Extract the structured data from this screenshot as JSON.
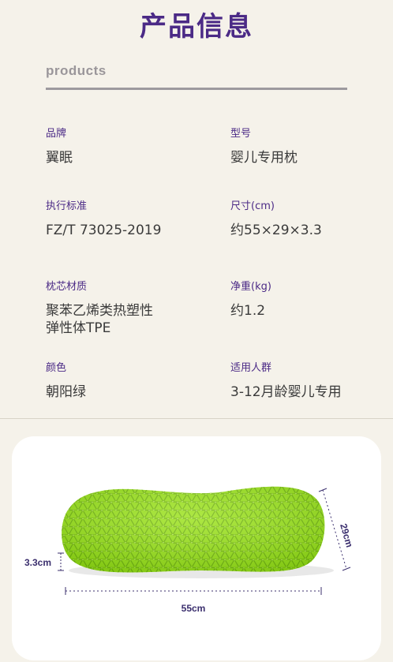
{
  "header": {
    "title": "产品信息",
    "subtitle": "products"
  },
  "specs": [
    {
      "label": "品牌",
      "value": "翼眠"
    },
    {
      "label": "型号",
      "value": "婴儿专用枕"
    },
    {
      "label": "执行标准",
      "value": "FZ/T 73025-2019"
    },
    {
      "label": "尺寸(cm)",
      "value": "约55×29×3.3"
    },
    {
      "label": "枕芯材质",
      "value_line1": "聚苯乙烯类热塑性",
      "value_line2": "弹性体TPE"
    },
    {
      "label": "净重(kg)",
      "value": "约1.2"
    },
    {
      "label": "颜色",
      "value": "朝阳绿"
    },
    {
      "label": "适用人群",
      "value": "3-12月龄婴儿专用"
    }
  ],
  "diagram": {
    "height_label": "3.3cm",
    "width_label": "55cm",
    "depth_label": "29cm",
    "pillow_color": "#9be21a",
    "accent_color": "#3b2f6e"
  }
}
